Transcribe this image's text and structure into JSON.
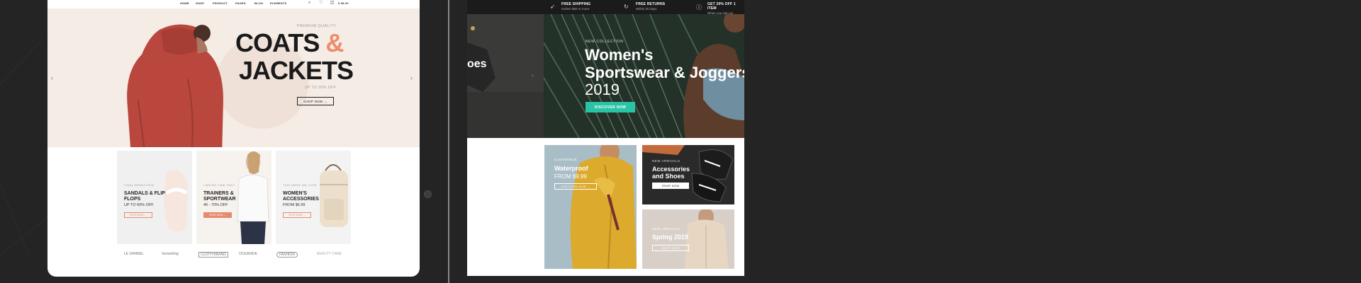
{
  "left_site": {
    "nav": [
      "HOME",
      "SHOP",
      "PRODUCT",
      "PAGES",
      "BLOG",
      "ELEMENTS"
    ],
    "cart_label": "$ 98.00",
    "hero": {
      "kicker": "PREMIUM QUALITY",
      "title_1": "COATS",
      "title_amp": "&",
      "title_2": "JACKETS",
      "sub": "UP TO 30% OFF",
      "button": "SHOP NOW →"
    },
    "cards": [
      {
        "kicker": "FINAL REDUCTION",
        "title": "SANDALS & FLIP FLOPS",
        "sub": "UP TO 60% OFF",
        "button": "SHOP NOW →"
      },
      {
        "kicker": "LIMITED TIME ONLY",
        "title": "TRAINERS & SPORTWEAR",
        "sub": "40 - 70% OFF",
        "button": "SHOP NOW →"
      },
      {
        "kicker": "THIS WEEK WE LOVE",
        "title": "WOMEN'S ACCESSORIES",
        "sub": "FROM $6.99",
        "button": "SHOP NOW →"
      }
    ],
    "brand_logos": [
      "LE DANNEL",
      "Something",
      "CLOTH BRAND",
      "OCEANIDE",
      "FASHION",
      "BEAUTY CARE"
    ]
  },
  "right_site": {
    "features": [
      {
        "title": "FREE SHIPPING",
        "sub": "Orders $50 or more",
        "icon": "rocket-icon"
      },
      {
        "title": "FREE RETURNS",
        "sub": "Within 30 days",
        "icon": "return-icon"
      },
      {
        "title": "GET 20% OFF 1 ITEM",
        "sub": "When you sign up",
        "icon": "info-icon"
      }
    ],
    "hero": {
      "side_text": "oes",
      "kicker": "NEW COLLECTION",
      "title_1": "Women's",
      "title_2": "Sportswear & Joggers",
      "title_3": "2019",
      "button": "DISCOVER NOW"
    },
    "tiles": [
      {
        "kicker": "CLEARANCE",
        "title": "Waterproof",
        "sub": "FROM $9.99",
        "button": "DISCOVER NOW →"
      },
      {
        "kicker": "NEW ARRIVALS",
        "title": "Accessories and Shoes",
        "button": "SHOP NOW"
      },
      {
        "kicker": "NEW ARRIVALS",
        "title": "Spring 2019",
        "button": "SHOP NOW"
      }
    ]
  },
  "colors": {
    "background": "#242424",
    "accent_peach": "#ec8c6b",
    "accent_teal": "#2bc3a5",
    "coat_red": "#b9473d",
    "jacket_yellow": "#dcaa2c"
  }
}
